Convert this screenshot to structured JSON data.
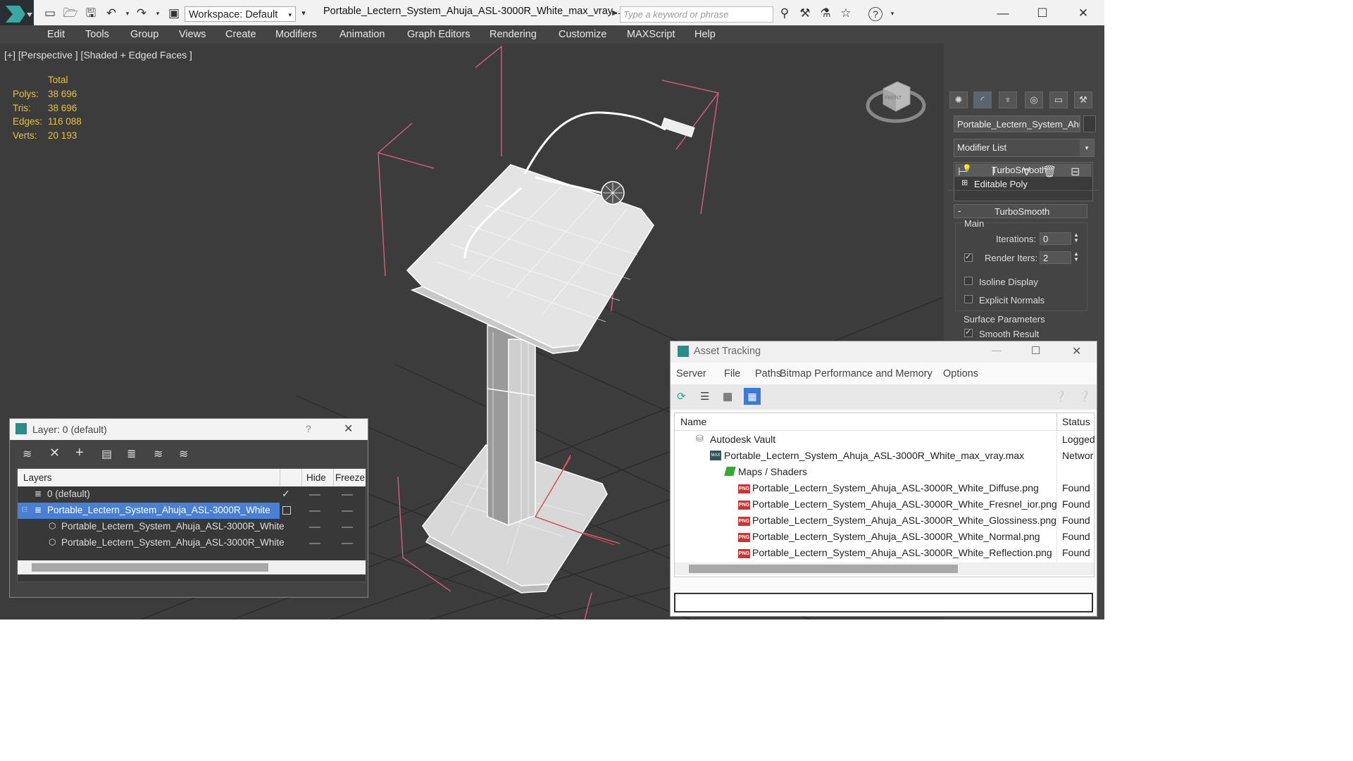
{
  "app": {
    "window_title": "Portable_Lectern_System_Ahuja_ASL-3000R_White_max_vray...",
    "workspace_label": "Workspace: Default",
    "search_placeholder": "Type a keyword or phrase",
    "help_symbol": "?"
  },
  "menu": [
    "Edit",
    "Tools",
    "Group",
    "Views",
    "Create",
    "Modifiers",
    "Animation",
    "Graph Editors",
    "Rendering",
    "Customize",
    "MAXScript",
    "Help"
  ],
  "viewport": {
    "label": "[+] [Perspective ] [Shaded + Edged Faces ]",
    "stats_header": "Total",
    "stats": [
      {
        "label": "Polys:",
        "value": "38 696"
      },
      {
        "label": "Tris:",
        "value": "38 696"
      },
      {
        "label": "Edges:",
        "value": "116 088"
      },
      {
        "label": "Verts:",
        "value": "20 193"
      }
    ],
    "viewcube_label": "FRONT"
  },
  "command_panel": {
    "object_name": "Portable_Lectern_System_Ahuja",
    "modifier_list_label": "Modifier List",
    "stack": [
      "TurboSmooth",
      "Editable Poly"
    ],
    "rollout_title": "TurboSmooth",
    "rollout_toggle": "-",
    "group_main": "Main",
    "iterations_label": "Iterations:",
    "iterations_value": "0",
    "render_iters_label": "Render Iters:",
    "render_iters_value": "2",
    "isoline_label": "Isoline Display",
    "explicit_normals_label": "Explicit Normals",
    "surface_params_label": "Surface Parameters",
    "smooth_result_label": "Smooth Result",
    "check_mark": "✓"
  },
  "layer_window": {
    "title": "Layer: 0 (default)",
    "help_symbol": "?",
    "col_layers": "Layers",
    "col_hide": "Hide",
    "col_freeze": "Freeze",
    "check_mark": "✓",
    "rows": [
      {
        "name": "0 (default)"
      },
      {
        "name": "Portable_Lectern_System_Ahuja_ASL-3000R_White"
      },
      {
        "name": "Portable_Lectern_System_Ahuja_ASL-3000R_White"
      },
      {
        "name": "Portable_Lectern_System_Ahuja_ASL-3000R_White"
      }
    ]
  },
  "asset_window": {
    "title": "Asset Tracking",
    "menu": [
      "Server",
      "File",
      "Paths",
      "Bitmap Performance and Memory",
      "Options"
    ],
    "col_name": "Name",
    "col_status": "Status",
    "png_tag": "PNG",
    "rows": [
      {
        "name": "Autodesk Vault",
        "status": "Logged"
      },
      {
        "name": "Portable_Lectern_System_Ahuja_ASL-3000R_White_max_vray.max",
        "status": "Networ"
      },
      {
        "name": "Maps / Shaders",
        "status": ""
      },
      {
        "name": "Portable_Lectern_System_Ahuja_ASL-3000R_White_Diffuse.png",
        "status": "Found"
      },
      {
        "name": "Portable_Lectern_System_Ahuja_ASL-3000R_White_Fresnel_ior.png",
        "status": "Found"
      },
      {
        "name": "Portable_Lectern_System_Ahuja_ASL-3000R_White_Glossiness.png",
        "status": "Found"
      },
      {
        "name": "Portable_Lectern_System_Ahuja_ASL-3000R_White_Normal.png",
        "status": "Found"
      },
      {
        "name": "Portable_Lectern_System_Ahuja_ASL-3000R_White_Reflection.png",
        "status": "Found"
      }
    ]
  },
  "colors": {
    "viewport_bg": "#3c3c3c",
    "stats_text": "#e6c040",
    "selection": "#4a7fd6",
    "bbox": "#e06080"
  }
}
